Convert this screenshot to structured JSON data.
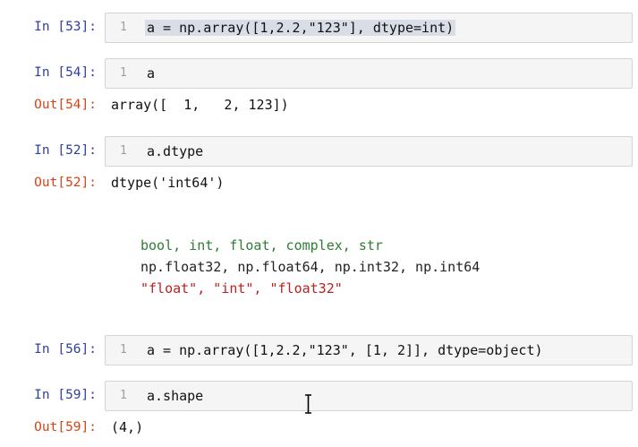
{
  "cells": [
    {
      "in_label": "In [53]:",
      "line": "1",
      "code": "a = np.array([1,2.2,\"123\"], dtype=int)"
    },
    {
      "in_label": "In [54]:",
      "line": "1",
      "code": "a",
      "out_label": "Out[54]:",
      "output": "array([  1,   2, 123])"
    },
    {
      "in_label": "In [52]:",
      "line": "1",
      "code": "a.dtype",
      "out_label": "Out[52]:",
      "output": "dtype('int64')"
    },
    {
      "in_label": "In [56]:",
      "line": "1",
      "code": "a = np.array([1,2.2,\"123\", [1, 2]], dtype=object)"
    },
    {
      "in_label": "In [59]:",
      "line": "1",
      "code": "a.shape",
      "out_label": "Out[59]:",
      "output": "(4,)"
    }
  ],
  "notes": {
    "line1": "bool, int, float, complex, str",
    "line2": "np.float32, np.float64, np.int32, np.int64",
    "line3": "\"float\", \"int\", \"float32\""
  },
  "colors": {
    "in_prompt": "#303f9f",
    "out_prompt": "#d84315",
    "green": "#2e7d32",
    "string_red": "#ba2121"
  },
  "icons": {
    "cursor": "text-cursor-icon"
  }
}
